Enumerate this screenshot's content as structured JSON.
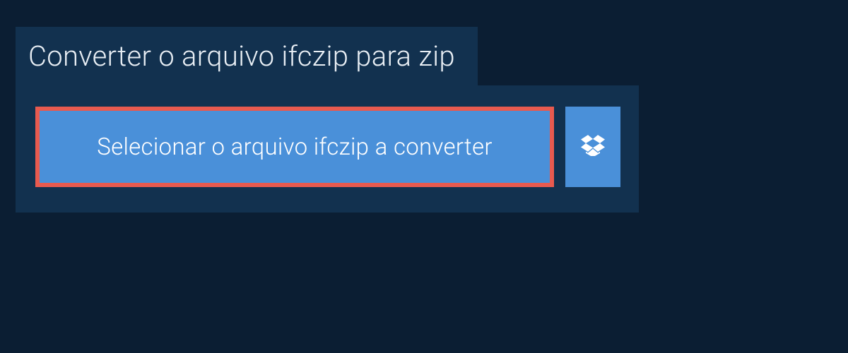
{
  "header": {
    "title": "Converter o arquivo ifczip para zip"
  },
  "actions": {
    "select_label": "Selecionar o arquivo ifczip a converter"
  },
  "colors": {
    "page_bg": "#0b1e33",
    "panel_bg": "#12314f",
    "button_bg": "#4a90d9",
    "highlight_border": "#e85a4f",
    "text_light": "#e8eef4",
    "text_white": "#ffffff"
  },
  "icons": {
    "dropbox": "dropbox-icon"
  }
}
